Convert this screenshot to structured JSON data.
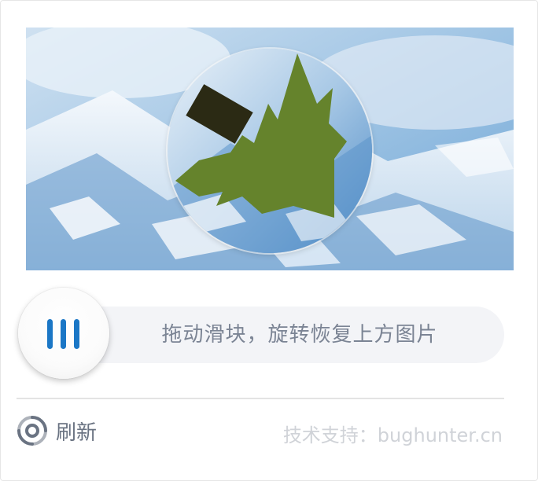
{
  "captcha": {
    "slider_hint": "拖动滑块，旋转恢复上方图片",
    "refresh_label": "刷新",
    "support_text": "技术支持：bughunter.cn"
  },
  "icons": {
    "slider_handle": "grip-lines-icon",
    "refresh": "refresh-icon"
  },
  "colors": {
    "accent": "#1b77c6",
    "hint_text": "#7b8494",
    "support_text": "#d0d3d8",
    "track": "#f3f4f7"
  }
}
